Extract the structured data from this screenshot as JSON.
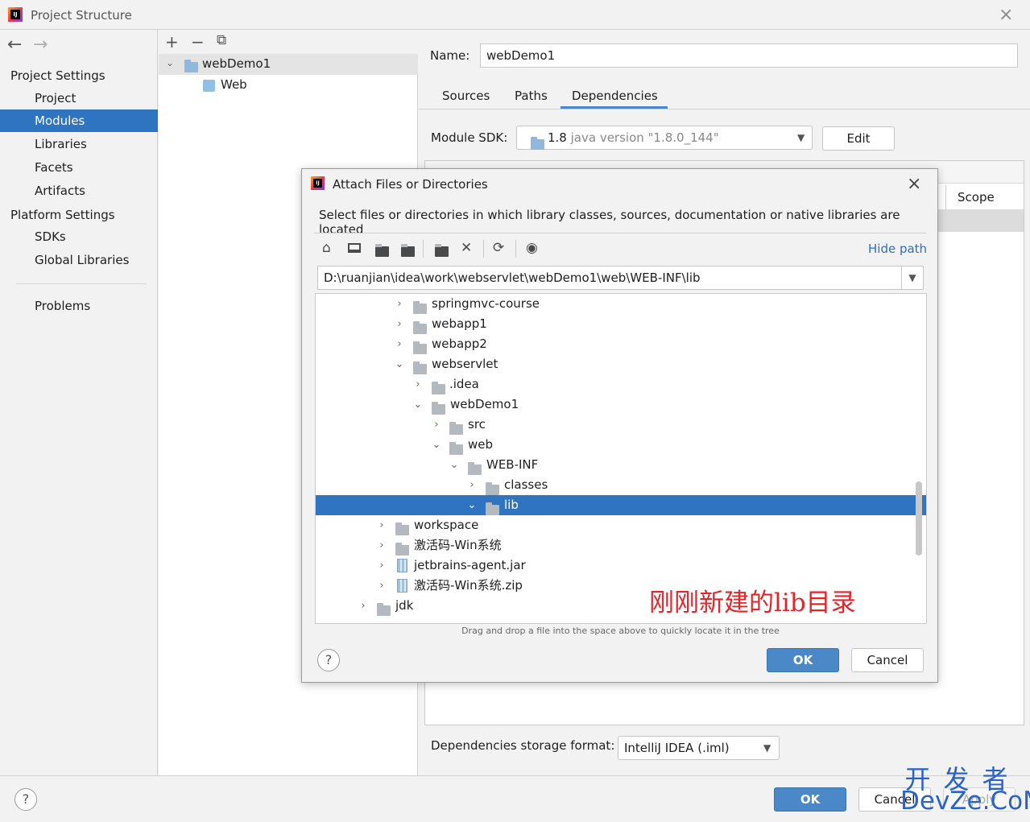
{
  "window": {
    "title": "Project Structure",
    "close": "×"
  },
  "nav": {
    "back": "←",
    "forward": "→",
    "project_settings": "Project Settings",
    "project_items": [
      "Project",
      "Modules",
      "Libraries",
      "Facets",
      "Artifacts"
    ],
    "platform_settings": "Platform Settings",
    "platform_items": [
      "SDKs",
      "Global Libraries"
    ],
    "problems": "Problems",
    "selected": "Modules"
  },
  "modules": {
    "toolbar": {
      "add": "+",
      "remove": "−",
      "copy": "⧉"
    },
    "items": [
      {
        "name": "webDemo1"
      },
      {
        "name": "Web"
      }
    ]
  },
  "module_detail": {
    "name_label": "Name:",
    "name_value": "webDemo1",
    "tabs": [
      "Sources",
      "Paths",
      "Dependencies"
    ],
    "active_tab": "Dependencies",
    "sdk_label": "Module SDK:",
    "sdk_version": "1.8",
    "sdk_detail": " java version \"1.8.0_144\"",
    "edit_label": "Edit",
    "scope_header": "Scope",
    "storage_label": "Dependencies storage format:",
    "storage_value": "IntelliJ IDEA (.iml)"
  },
  "footer": {
    "help": "?",
    "ok": "OK",
    "cancel": "Cancel",
    "apply": "Apply"
  },
  "watermark": {
    "line1": "开发者",
    "line2": "DevZe.CoM"
  },
  "dialog": {
    "title": "Attach Files or Directories",
    "close": "×",
    "description": "Select files or directories in which library classes, sources, documentation or native libraries are located",
    "toolbar_icons": [
      "home-icon",
      "desktop-icon",
      "project-folder-icon",
      "module-folder-icon",
      "new-folder-icon",
      "delete-icon",
      "refresh-icon",
      "show-hidden-icon"
    ],
    "hide_path": "Hide path",
    "path": "D:\\ruanjian\\idea\\work\\webservlet\\webDemo1\\web\\WEB-INF\\lib",
    "tree": [
      {
        "label": "springmvc-course",
        "expanded": false,
        "type": "folder"
      },
      {
        "label": "webapp1",
        "expanded": false,
        "type": "folder"
      },
      {
        "label": "webapp2",
        "expanded": false,
        "type": "folder"
      },
      {
        "label": "webservlet",
        "expanded": true,
        "type": "folder"
      },
      {
        "label": ".idea",
        "expanded": false,
        "type": "folder"
      },
      {
        "label": "webDemo1",
        "expanded": true,
        "type": "folder"
      },
      {
        "label": "src",
        "expanded": false,
        "type": "folder"
      },
      {
        "label": "web",
        "expanded": true,
        "type": "folder"
      },
      {
        "label": "WEB-INF",
        "expanded": true,
        "type": "folder"
      },
      {
        "label": "classes",
        "expanded": false,
        "type": "folder"
      },
      {
        "label": "lib",
        "expanded": true,
        "type": "folder",
        "selected": true
      },
      {
        "label": "workspace",
        "expanded": false,
        "type": "folder"
      },
      {
        "label": "激活码-Win系统",
        "expanded": false,
        "type": "folder"
      },
      {
        "label": "jetbrains-agent.jar",
        "expanded": false,
        "type": "jar"
      },
      {
        "label": "激活码-Win系统.zip",
        "expanded": false,
        "type": "jar"
      },
      {
        "label": "jdk",
        "expanded": false,
        "type": "folder"
      }
    ],
    "annotation": "刚刚新建的lib目录",
    "drag_hint": "Drag and drop a file into the space above to quickly locate it in the tree",
    "help": "?",
    "ok": "OK",
    "cancel": "Cancel"
  }
}
